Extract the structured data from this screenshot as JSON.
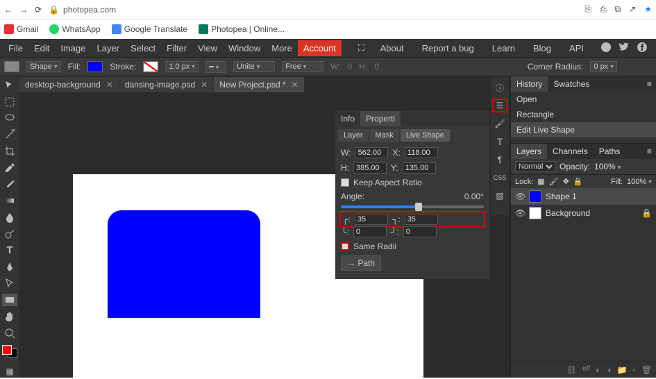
{
  "browser": {
    "url": "photopea.com"
  },
  "bookmarks": {
    "gmail": "Gmail",
    "whatsapp": "WhatsApp",
    "translate": "Google Translate",
    "photopea": "Photopea | Online..."
  },
  "menu": {
    "file": "File",
    "edit": "Edit",
    "image": "Image",
    "layer": "Layer",
    "select": "Select",
    "filter": "Filter",
    "view": "View",
    "window": "Window",
    "more": "More",
    "account": "Account",
    "about": "About",
    "bug": "Report a bug",
    "learn": "Learn",
    "blog": "Blog",
    "api": "API"
  },
  "options": {
    "shape": "Shape",
    "fill": "Fill:",
    "stroke": "Stroke:",
    "strokew": "1.0 px",
    "bool": "Unite",
    "align": "Free",
    "wlabel": "W:",
    "wval": "0",
    "hlabel": "H:",
    "hval": "0",
    "radiuslabel": "Corner Radius:",
    "radiusval": "0 px"
  },
  "tabs": {
    "t1": "desktop-background",
    "t2": "dansing-image.psd",
    "t3": "New Project.psd *"
  },
  "panel": {
    "info": "Info",
    "properties": "Properti",
    "layer": "Layer",
    "mask": "Mask",
    "liveshape": "Live Shape",
    "wlabel": "W:",
    "wval": "562.00",
    "xlabel": "X:",
    "xval": "118.00",
    "hlabel": "H:",
    "hval": "385.00",
    "ylabel": "Y:",
    "yval": "135.00",
    "keepratio": "Keep Aspect Ratio",
    "anglelabel": "Angle:",
    "angleval": "0.00°",
    "tl": "35",
    "tr": "35",
    "bl": "0",
    "br": "0",
    "sameradii": "Same Radii",
    "path": "→ Path"
  },
  "history": {
    "tab1": "History",
    "tab2": "Swatches",
    "i1": "Open",
    "i2": "Rectangle",
    "i3": "Edit Live Shape"
  },
  "layers": {
    "tab1": "Layers",
    "tab2": "Channels",
    "tab3": "Paths",
    "mode": "Normal",
    "oplabel": "Opacity:",
    "opval": "100%",
    "locklabel": "Lock:",
    "filllabel": "Fill:",
    "fillval": "100%",
    "l1": "Shape 1",
    "l2": "Background"
  }
}
